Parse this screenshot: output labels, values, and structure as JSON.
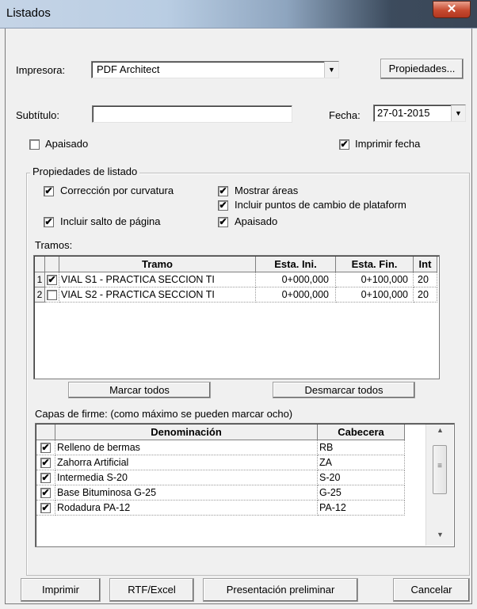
{
  "window": {
    "title": "Listados",
    "close_glyph": "✕"
  },
  "printer": {
    "label": "Impresora:",
    "value": "PDF Architect",
    "properties_button": "Propiedades..."
  },
  "subtitle": {
    "label": "Subtítulo:",
    "value": ""
  },
  "date": {
    "label": "Fecha:",
    "value": "27-01-2015"
  },
  "landscape": {
    "label": "Apaisado",
    "checked": false
  },
  "print_date": {
    "label": "Imprimir fecha",
    "checked": true
  },
  "list_properties": {
    "title": "Propiedades de listado",
    "options": {
      "curvature": {
        "label": "Corrección por curvatura",
        "checked": true
      },
      "show_areas": {
        "label": "Mostrar áreas",
        "checked": true
      },
      "platform_points": {
        "label": "Incluir puntos de cambio de plataform",
        "checked": true
      },
      "page_break": {
        "label": "Incluir salto de página",
        "checked": true
      },
      "landscape": {
        "label": "Apaisado",
        "checked": true
      }
    }
  },
  "tramos": {
    "label": "Tramos:",
    "columns": [
      "Tramo",
      "Esta. Ini.",
      "Esta. Fin.",
      "Int"
    ],
    "rows": [
      {
        "num": "1",
        "checked": true,
        "tramo": "VIAL S1 - PRACTICA SECCION TI",
        "ini": "0+000,000",
        "fin": "0+100,000",
        "int": "20"
      },
      {
        "num": "2",
        "checked": false,
        "tramo": "VIAL S2 - PRACTICA SECCION TI",
        "ini": "0+000,000",
        "fin": "0+100,000",
        "int": "20"
      }
    ],
    "mark_all": "Marcar todos",
    "unmark_all": "Desmarcar todos"
  },
  "capas": {
    "label": "Capas de firme: (como máximo se pueden marcar ocho)",
    "columns": [
      "Denominación",
      "Cabecera"
    ],
    "rows": [
      {
        "checked": true,
        "name": "Relleno de bermas",
        "code": "RB"
      },
      {
        "checked": true,
        "name": "Zahorra Artificial",
        "code": "ZA"
      },
      {
        "checked": true,
        "name": "Intermedia S-20",
        "code": "S-20"
      },
      {
        "checked": true,
        "name": "Base Bituminosa G-25",
        "code": "G-25"
      },
      {
        "checked": true,
        "name": "Rodadura PA-12",
        "code": "PA-12"
      }
    ]
  },
  "footer": {
    "print": "Imprimir",
    "rtf_excel": "RTF/Excel",
    "preview": "Presentación preliminar",
    "cancel": "Cancelar"
  },
  "colors": {
    "titlebar_dark": "#3c4b5d",
    "close_red": "#c64a30",
    "dialog_bg": "#f0f0f0"
  },
  "icons": {
    "dropdown": "▼",
    "check": "✔",
    "scroll_up": "▲",
    "scroll_down": "▼",
    "scroll_grip": "≡"
  }
}
